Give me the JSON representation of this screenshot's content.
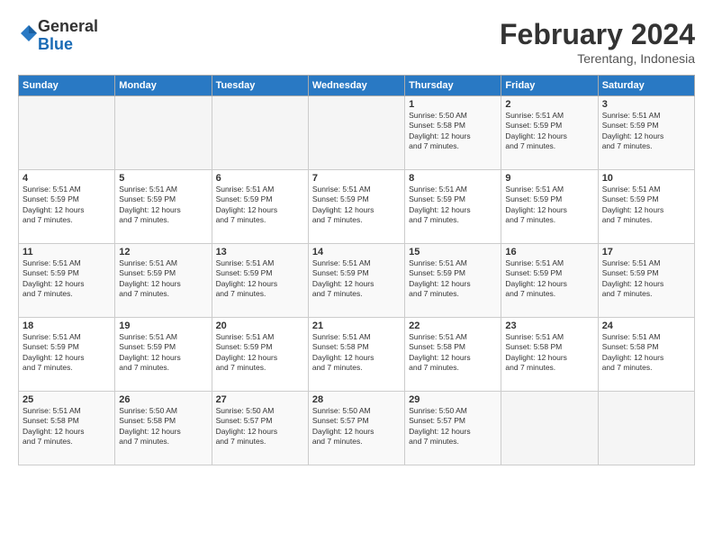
{
  "logo": {
    "general": "General",
    "blue": "Blue"
  },
  "title": "February 2024",
  "subtitle": "Terentang, Indonesia",
  "days_header": [
    "Sunday",
    "Monday",
    "Tuesday",
    "Wednesday",
    "Thursday",
    "Friday",
    "Saturday"
  ],
  "weeks": [
    [
      {
        "day": "",
        "info": ""
      },
      {
        "day": "",
        "info": ""
      },
      {
        "day": "",
        "info": ""
      },
      {
        "day": "",
        "info": ""
      },
      {
        "day": "1",
        "info": "Sunrise: 5:50 AM\nSunset: 5:58 PM\nDaylight: 12 hours\nand 7 minutes."
      },
      {
        "day": "2",
        "info": "Sunrise: 5:51 AM\nSunset: 5:59 PM\nDaylight: 12 hours\nand 7 minutes."
      },
      {
        "day": "3",
        "info": "Sunrise: 5:51 AM\nSunset: 5:59 PM\nDaylight: 12 hours\nand 7 minutes."
      }
    ],
    [
      {
        "day": "4",
        "info": "Sunrise: 5:51 AM\nSunset: 5:59 PM\nDaylight: 12 hours\nand 7 minutes."
      },
      {
        "day": "5",
        "info": "Sunrise: 5:51 AM\nSunset: 5:59 PM\nDaylight: 12 hours\nand 7 minutes."
      },
      {
        "day": "6",
        "info": "Sunrise: 5:51 AM\nSunset: 5:59 PM\nDaylight: 12 hours\nand 7 minutes."
      },
      {
        "day": "7",
        "info": "Sunrise: 5:51 AM\nSunset: 5:59 PM\nDaylight: 12 hours\nand 7 minutes."
      },
      {
        "day": "8",
        "info": "Sunrise: 5:51 AM\nSunset: 5:59 PM\nDaylight: 12 hours\nand 7 minutes."
      },
      {
        "day": "9",
        "info": "Sunrise: 5:51 AM\nSunset: 5:59 PM\nDaylight: 12 hours\nand 7 minutes."
      },
      {
        "day": "10",
        "info": "Sunrise: 5:51 AM\nSunset: 5:59 PM\nDaylight: 12 hours\nand 7 minutes."
      }
    ],
    [
      {
        "day": "11",
        "info": "Sunrise: 5:51 AM\nSunset: 5:59 PM\nDaylight: 12 hours\nand 7 minutes."
      },
      {
        "day": "12",
        "info": "Sunrise: 5:51 AM\nSunset: 5:59 PM\nDaylight: 12 hours\nand 7 minutes."
      },
      {
        "day": "13",
        "info": "Sunrise: 5:51 AM\nSunset: 5:59 PM\nDaylight: 12 hours\nand 7 minutes."
      },
      {
        "day": "14",
        "info": "Sunrise: 5:51 AM\nSunset: 5:59 PM\nDaylight: 12 hours\nand 7 minutes."
      },
      {
        "day": "15",
        "info": "Sunrise: 5:51 AM\nSunset: 5:59 PM\nDaylight: 12 hours\nand 7 minutes."
      },
      {
        "day": "16",
        "info": "Sunrise: 5:51 AM\nSunset: 5:59 PM\nDaylight: 12 hours\nand 7 minutes."
      },
      {
        "day": "17",
        "info": "Sunrise: 5:51 AM\nSunset: 5:59 PM\nDaylight: 12 hours\nand 7 minutes."
      }
    ],
    [
      {
        "day": "18",
        "info": "Sunrise: 5:51 AM\nSunset: 5:59 PM\nDaylight: 12 hours\nand 7 minutes."
      },
      {
        "day": "19",
        "info": "Sunrise: 5:51 AM\nSunset: 5:59 PM\nDaylight: 12 hours\nand 7 minutes."
      },
      {
        "day": "20",
        "info": "Sunrise: 5:51 AM\nSunset: 5:59 PM\nDaylight: 12 hours\nand 7 minutes."
      },
      {
        "day": "21",
        "info": "Sunrise: 5:51 AM\nSunset: 5:58 PM\nDaylight: 12 hours\nand 7 minutes."
      },
      {
        "day": "22",
        "info": "Sunrise: 5:51 AM\nSunset: 5:58 PM\nDaylight: 12 hours\nand 7 minutes."
      },
      {
        "day": "23",
        "info": "Sunrise: 5:51 AM\nSunset: 5:58 PM\nDaylight: 12 hours\nand 7 minutes."
      },
      {
        "day": "24",
        "info": "Sunrise: 5:51 AM\nSunset: 5:58 PM\nDaylight: 12 hours\nand 7 minutes."
      }
    ],
    [
      {
        "day": "25",
        "info": "Sunrise: 5:51 AM\nSunset: 5:58 PM\nDaylight: 12 hours\nand 7 minutes."
      },
      {
        "day": "26",
        "info": "Sunrise: 5:50 AM\nSunset: 5:58 PM\nDaylight: 12 hours\nand 7 minutes."
      },
      {
        "day": "27",
        "info": "Sunrise: 5:50 AM\nSunset: 5:57 PM\nDaylight: 12 hours\nand 7 minutes."
      },
      {
        "day": "28",
        "info": "Sunrise: 5:50 AM\nSunset: 5:57 PM\nDaylight: 12 hours\nand 7 minutes."
      },
      {
        "day": "29",
        "info": "Sunrise: 5:50 AM\nSunset: 5:57 PM\nDaylight: 12 hours\nand 7 minutes."
      },
      {
        "day": "",
        "info": ""
      },
      {
        "day": "",
        "info": ""
      }
    ]
  ]
}
